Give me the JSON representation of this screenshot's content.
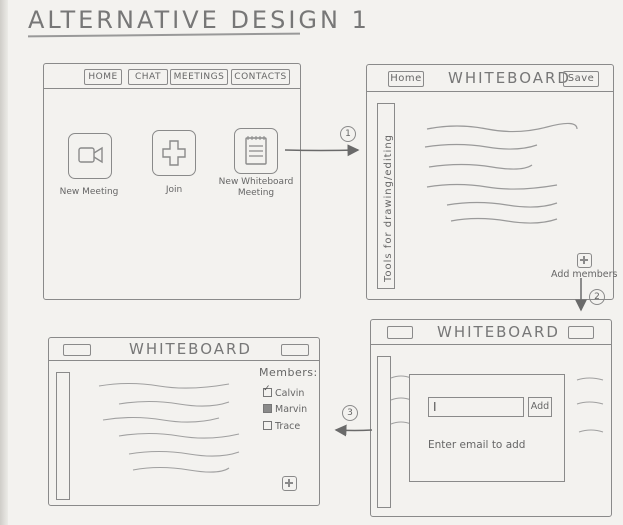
{
  "title": "ALTERNATIVE DESIGN 1",
  "screen1": {
    "nav": [
      "HOME",
      "CHAT",
      "MEETINGS",
      "CONTACTS"
    ],
    "tiles": [
      {
        "icon": "video-camera-icon",
        "label": "New Meeting"
      },
      {
        "icon": "plus-icon",
        "label": "Join"
      },
      {
        "icon": "notepad-icon",
        "label_line1": "New Whiteboard",
        "label_line2": "Meeting"
      }
    ]
  },
  "screen2": {
    "home_label": "Home",
    "title": "WHITEBOARD",
    "save_label": "Save",
    "tools_label": "Tools for drawing/editing",
    "add_members_label": "Add members"
  },
  "screen3": {
    "title": "WHITEBOARD",
    "email_placeholder": "I",
    "add_label": "Add",
    "hint": "Enter email to add"
  },
  "screen4": {
    "title": "WHITEBOARD",
    "members_title": "Members:",
    "members": [
      {
        "name": "Calvin",
        "state": "checked"
      },
      {
        "name": "Marvin",
        "state": "filled"
      },
      {
        "name": "Trace",
        "state": "empty"
      }
    ]
  },
  "flow_markers": [
    "1",
    "2",
    "3"
  ]
}
